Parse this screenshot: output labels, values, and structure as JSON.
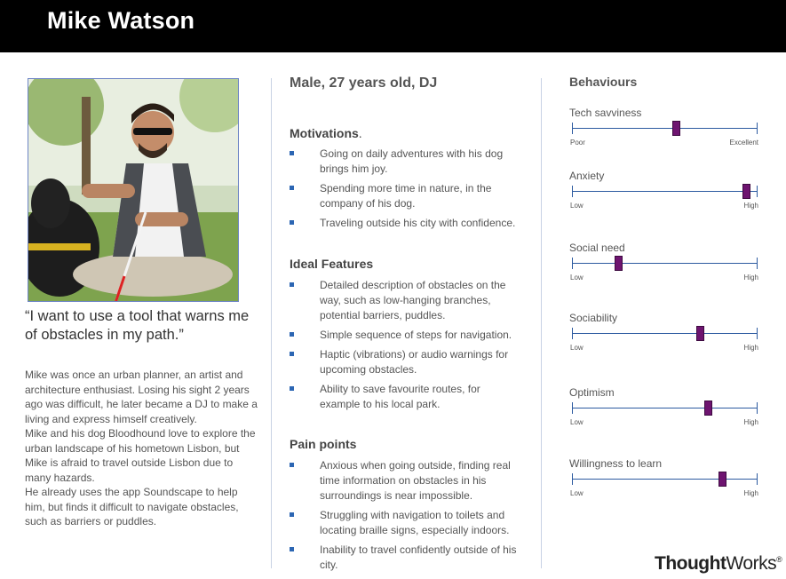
{
  "name": "Mike Watson",
  "quote": "“I want to use a tool that warns me of obstacles in my path.”",
  "bio": [
    "Mike was once an urban planner, an artist and architecture enthusiast. Losing his sight 2 years ago was difficult, he later became a DJ to make a living and express himself creatively.",
    "Mike and his dog Bloodhound love to explore the urban landscape of his hometown Lisbon, but Mike is afraid to travel outside Lisbon due to many hazards.",
    "He already uses the app Soundscape to help him, but finds it difficult to navigate obstacles, such as barriers or puddles."
  ],
  "demographics": "Male, 27 years old, DJ",
  "motivations": {
    "title": "Motivations",
    "items": [
      "Going on daily adventures with his dog brings him joy.",
      "Spending more time in nature, in the company of his dog.",
      "Traveling outside his city with confidence."
    ]
  },
  "ideal_features": {
    "title": "Ideal Features",
    "items": [
      "Detailed description of obstacles on the way, such as low-hanging branches, potential barriers, puddles.",
      "Simple sequence of steps for navigation.",
      "Haptic (vibrations) or audio warnings for upcoming obstacles.",
      "Ability to save favourite routes, for example to his local park."
    ]
  },
  "pain_points": {
    "title": "Pain points",
    "items": [
      "Anxious when going outside, finding real time information on obstacles in his surroundings is near impossible.",
      "Struggling with navigation to toilets and locating braille signs, especially indoors.",
      "Inability to travel confidently outside of his city."
    ]
  },
  "behaviours": {
    "title": "Behaviours",
    "items": [
      {
        "label": "Tech savviness",
        "low": "Poor",
        "high": "Excellent",
        "value": 0.56
      },
      {
        "label": "Anxiety",
        "low": "Low",
        "high": "High",
        "value": 0.94
      },
      {
        "label": "Social need",
        "low": "Low",
        "high": "High",
        "value": 0.25
      },
      {
        "label": "Sociability",
        "low": "Low",
        "high": "High",
        "value": 0.69
      },
      {
        "label": "Optimism",
        "low": "Low",
        "high": "High",
        "value": 0.73
      },
      {
        "label": "Willingness to learn",
        "low": "Low",
        "high": "High",
        "value": 0.81
      }
    ]
  },
  "logo": {
    "bold": "Thought",
    "normal": "Works",
    "mark": "®"
  },
  "colors": {
    "knob": "#6e1470",
    "track": "#2c5aa0",
    "bullet": "#2c66b3",
    "header": "#000000"
  }
}
